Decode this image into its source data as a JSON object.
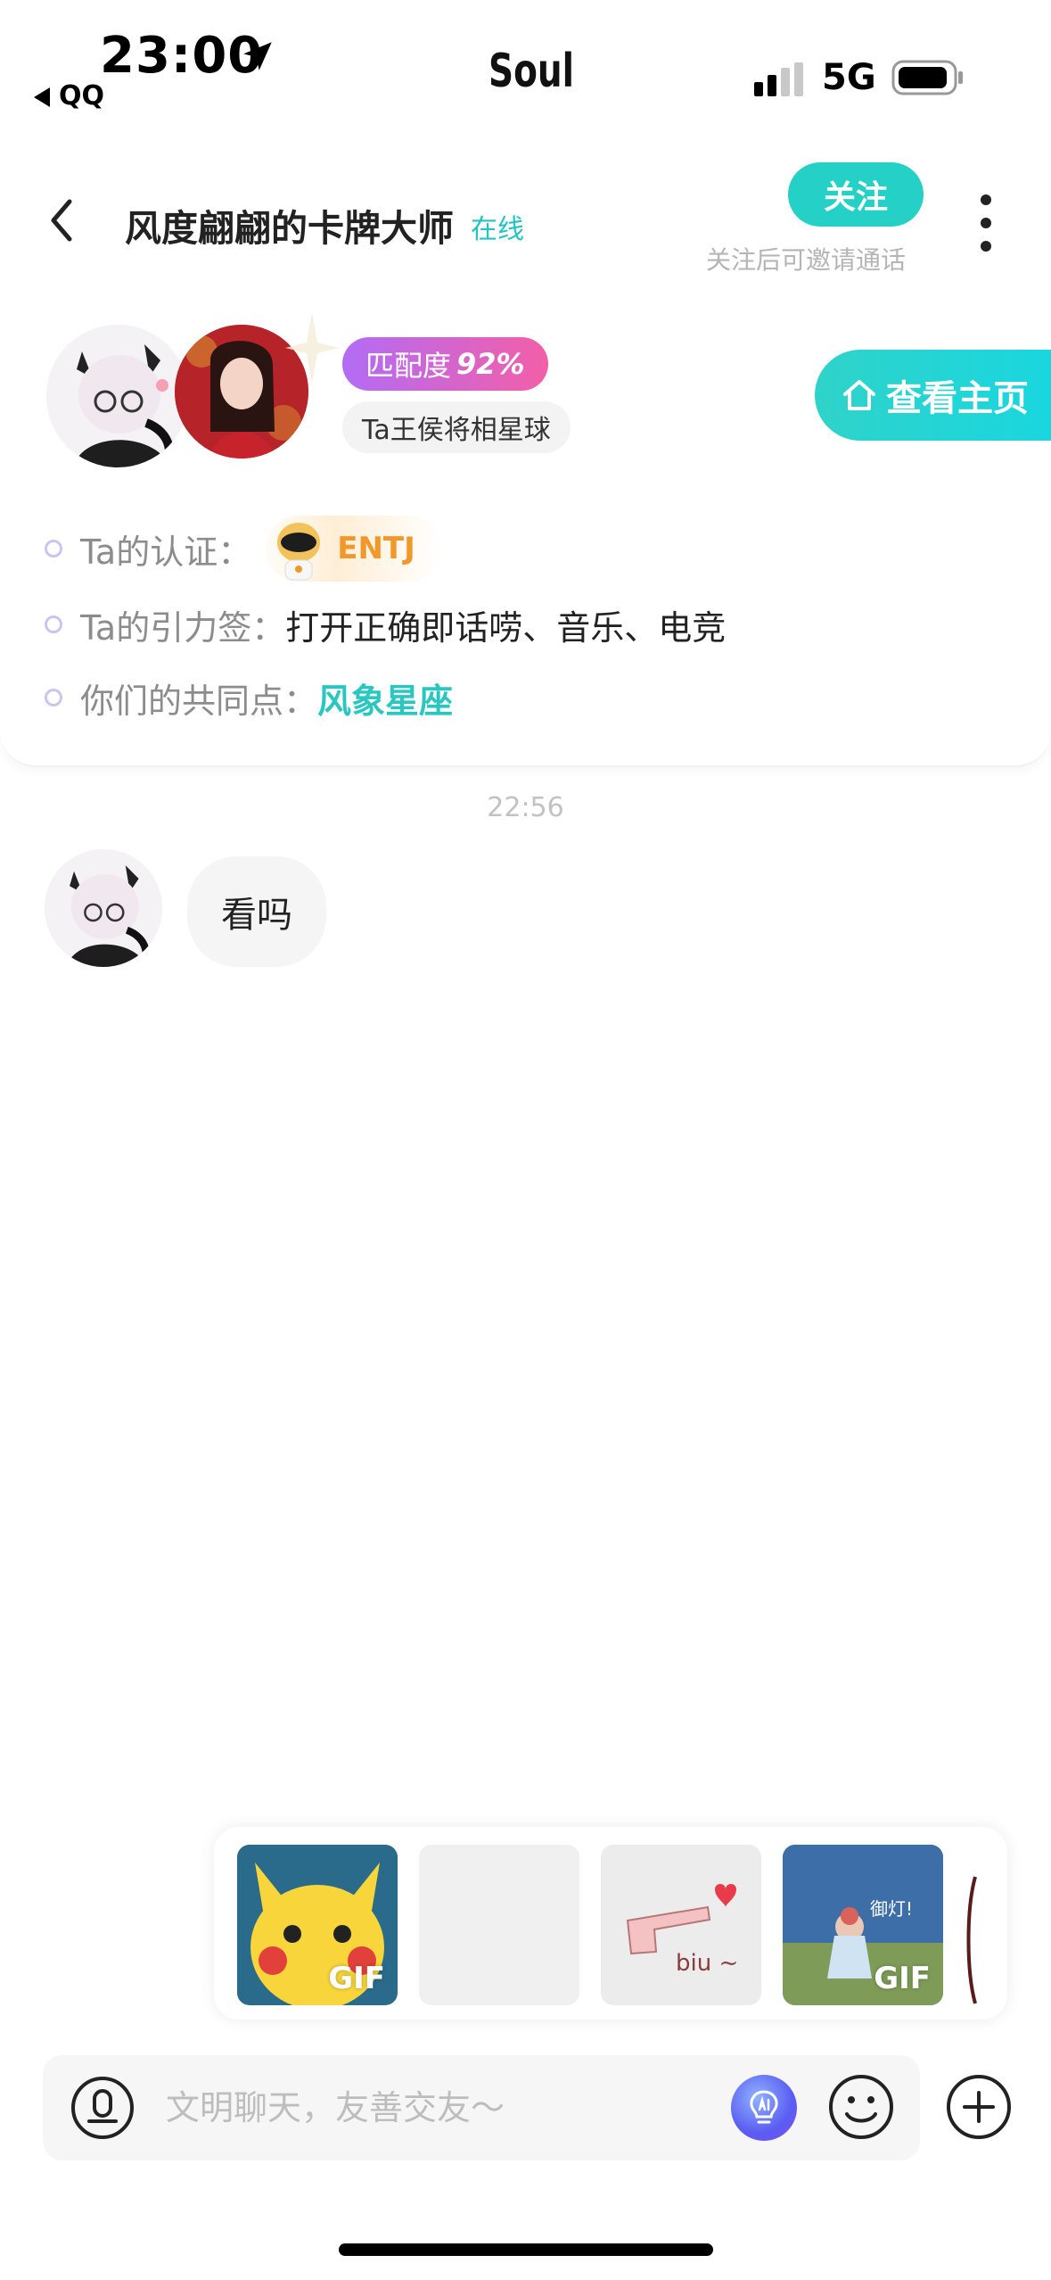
{
  "status_bar": {
    "time": "23:00",
    "back_app": "QQ",
    "app_logo": "Soul",
    "network": "5G"
  },
  "header": {
    "title": "风度翩翩的卡牌大师",
    "status": "在线",
    "follow_label": "关注",
    "follow_hint": "关注后可邀请通话"
  },
  "profile": {
    "match_label": "匹配度",
    "match_value": "92%",
    "planet": "Ta王侯将相星球",
    "view_home": "查看主页",
    "info": [
      {
        "label": "Ta的认证：",
        "value": "ENTJ"
      },
      {
        "label": "Ta的引力签：",
        "value": "打开正确即话唠、音乐、电竞"
      },
      {
        "label": "你们的共同点：",
        "value": "风象星座"
      }
    ]
  },
  "chat": {
    "timestamp": "22:56",
    "messages": [
      {
        "from": "other",
        "text": "看吗"
      }
    ]
  },
  "stickers": {
    "items": [
      {
        "icon": "pikachu-sticker",
        "badge": "GIF"
      },
      {
        "icon": "blank-sticker",
        "badge": ""
      },
      {
        "icon": "biu-hand-sticker",
        "badge": "",
        "caption": "biu ~"
      },
      {
        "icon": "sky-character-sticker",
        "badge": "GIF",
        "caption": "御灯!"
      }
    ]
  },
  "input": {
    "placeholder": "文明聊天，友善交友～"
  },
  "colors": {
    "accent": "#25d0c6",
    "match_gradient_start": "#b26cf5",
    "match_gradient_end": "#f35fa7",
    "mbti": "#f0982a"
  }
}
